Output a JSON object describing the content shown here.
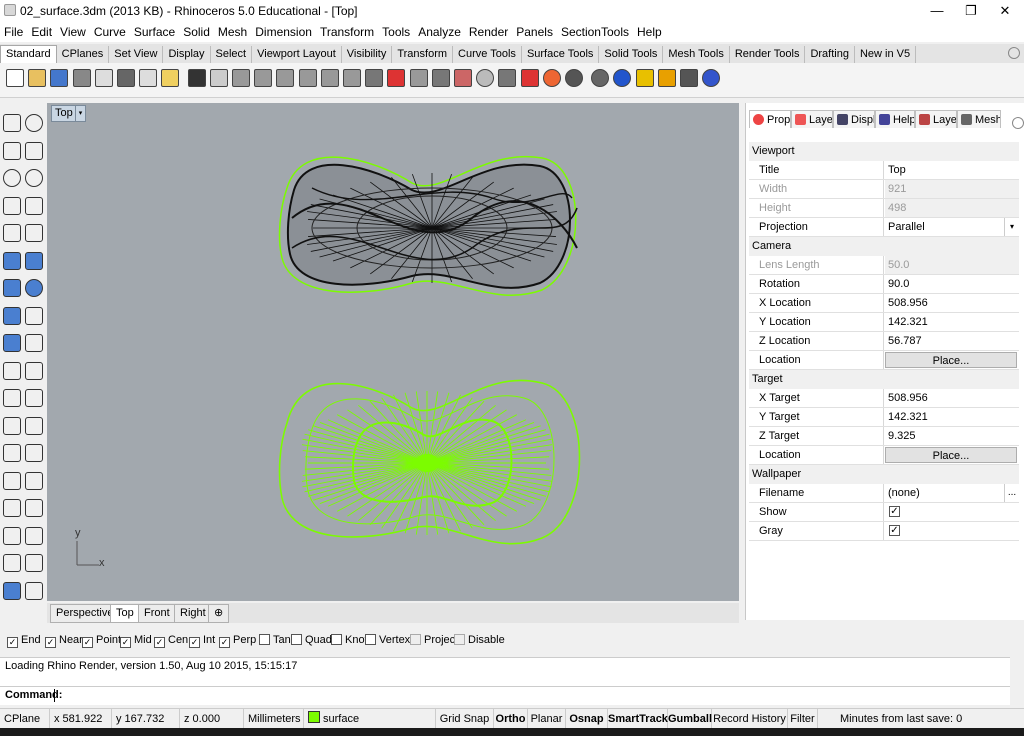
{
  "window": {
    "title": "02_surface.3dm (2013 KB) - Rhinoceros 5.0 Educational - [Top]",
    "minimize_glyph": "—",
    "restore_glyph": "❐",
    "close_glyph": "✕"
  },
  "menu": [
    "File",
    "Edit",
    "View",
    "Curve",
    "Surface",
    "Solid",
    "Mesh",
    "Dimension",
    "Transform",
    "Tools",
    "Analyze",
    "Render",
    "Panels",
    "SectionTools",
    "Help"
  ],
  "toolbar_tabs": [
    "Standard",
    "CPlanes",
    "Set View",
    "Display",
    "Select",
    "Viewport Layout",
    "Visibility",
    "Transform",
    "Curve Tools",
    "Surface Tools",
    "Solid Tools",
    "Mesh Tools",
    "Render Tools",
    "Drafting",
    "New in V5"
  ],
  "toolbar_active_tab": "Standard",
  "toolbar_icons": [
    "new-icon",
    "open-icon",
    "save-icon",
    "print-icon",
    "import-icon",
    "cut-icon",
    "copy-icon",
    "paste-icon",
    "undo-icon",
    "pan-icon",
    "rotate-view-icon",
    "zoom-dynamic-icon",
    "zoom-window-icon",
    "zoom-extents-icon",
    "zoom-selected-icon",
    "rotate-camera-icon",
    "four-viewports-icon",
    "car-icon",
    "select-icon",
    "grid-icon",
    "layer-icon",
    "light-icon",
    "lock-icon",
    "shield-icon",
    "color-wheel-icon",
    "shaded-sphere-icon",
    "rendered-sphere-icon",
    "blue-sphere-icon",
    "paint-icon",
    "gear-tools-icon",
    "dimension-icon",
    "help-icon"
  ],
  "viewport": {
    "label": "Top",
    "arrow": "▾",
    "axis_x": "x",
    "axis_y": "y",
    "background": "#a2a8ae",
    "accent_green": "#7cfc00"
  },
  "viewport_tabs": [
    "Perspective",
    "Top",
    "Front",
    "Right",
    "⊕"
  ],
  "viewport_active_tab": "Top",
  "panel": {
    "tabs": [
      {
        "label": "Prop...",
        "icon": "properties-icon",
        "color": "#e44"
      },
      {
        "label": "Laye...",
        "icon": "layers-icon",
        "color": "#e55"
      },
      {
        "label": "Displ...",
        "icon": "display-icon",
        "color": "#446"
      },
      {
        "label": "Help",
        "icon": "help-panel-icon",
        "color": "#449"
      },
      {
        "label": "Laye...",
        "icon": "layer-state-icon",
        "color": "#b44"
      },
      {
        "label": "Mesh...",
        "icon": "mesh-icon",
        "color": "#666"
      }
    ],
    "sections": {
      "viewport": "Viewport",
      "camera": "Camera",
      "target": "Target",
      "wallpaper": "Wallpaper"
    },
    "viewport_rows": [
      {
        "key": "Title",
        "value": "Top",
        "disabled": false
      },
      {
        "key": "Width",
        "value": "921",
        "disabled": true
      },
      {
        "key": "Height",
        "value": "498",
        "disabled": true
      },
      {
        "key": "Projection",
        "value": "Parallel",
        "disabled": false
      }
    ],
    "camera_rows": [
      {
        "key": "Lens Length",
        "value": "50.0",
        "disabled": true
      },
      {
        "key": "Rotation",
        "value": "90.0",
        "disabled": false
      },
      {
        "key": "X Location",
        "value": "508.956",
        "disabled": false
      },
      {
        "key": "Y Location",
        "value": "142.321",
        "disabled": false
      },
      {
        "key": "Z Location",
        "value": "56.787",
        "disabled": false
      },
      {
        "key": "Location",
        "button": "Place...",
        "disabled": false
      }
    ],
    "target_rows": [
      {
        "key": "X Target",
        "value": "508.956",
        "disabled": false
      },
      {
        "key": "Y Target",
        "value": "142.321",
        "disabled": false
      },
      {
        "key": "Z Target",
        "value": "9.325",
        "disabled": false
      },
      {
        "key": "Location",
        "button": "Place...",
        "disabled": false
      }
    ],
    "wallpaper_rows": [
      {
        "key": "Filename",
        "value": "(none)",
        "disabled": false
      },
      {
        "key": "Show",
        "checked": true
      },
      {
        "key": "Gray",
        "checked": true
      }
    ],
    "browse_label": "..."
  },
  "osnap": [
    {
      "label": "End",
      "checked": true
    },
    {
      "label": "Near",
      "checked": true
    },
    {
      "label": "Point",
      "checked": true
    },
    {
      "label": "Mid",
      "checked": true
    },
    {
      "label": "Cen",
      "checked": true
    },
    {
      "label": "Int",
      "checked": true
    },
    {
      "label": "Perp",
      "checked": true
    },
    {
      "label": "Tan",
      "checked": false
    },
    {
      "label": "Quad",
      "checked": false
    },
    {
      "label": "Knot",
      "checked": false
    },
    {
      "label": "Vertex",
      "checked": false
    },
    {
      "label": "Project",
      "checked": false,
      "disabled": true
    },
    {
      "label": "Disable",
      "checked": false,
      "disabled": true
    }
  ],
  "command": {
    "history": "Loading Rhino Render, version 1.50, Aug 10 2015, 15:15:17",
    "prompt": "Command:"
  },
  "status": {
    "cplane": "CPlane",
    "x": "x 581.922",
    "y": "y 167.732",
    "z": "z 0.000",
    "units": "Millimeters",
    "layer": "surface",
    "layer_color": "#7cfc00",
    "toggles": [
      {
        "label": "Grid Snap",
        "bold": false
      },
      {
        "label": "Ortho",
        "bold": true
      },
      {
        "label": "Planar",
        "bold": false
      },
      {
        "label": "Osnap",
        "bold": true
      },
      {
        "label": "SmartTrack",
        "bold": true
      },
      {
        "label": "Gumball",
        "bold": true
      },
      {
        "label": "Record History",
        "bold": false
      },
      {
        "label": "Filter",
        "bold": false
      }
    ],
    "last_save": "Minutes from last save: 0"
  }
}
